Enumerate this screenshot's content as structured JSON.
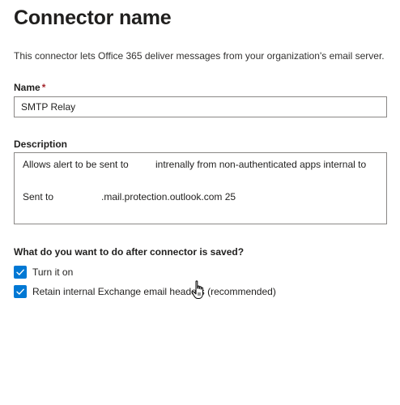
{
  "page": {
    "title": "Connector name",
    "subtitle": "This connector lets Office 365 deliver messages from your organization's email server."
  },
  "name_field": {
    "label": "Name",
    "required_marker": "*",
    "value": "SMTP Relay"
  },
  "description_field": {
    "label": "Description",
    "line1_part1": "Allows alert to be sent to",
    "line1_part2": "intrenally from non-authenticated apps internal to",
    "line2_part1": "Sent to",
    "line2_part2": ".mail.protection.outlook.com 25"
  },
  "options": {
    "question": "What do you want to do after connector is saved?",
    "items": [
      {
        "label": "Turn it on",
        "checked": true
      },
      {
        "label": "Retain internal Exchange email headers (recommended)",
        "checked": true
      }
    ]
  },
  "icons": {
    "checkmark": "checkmark-icon",
    "cursor": "hand-pointer-cursor-icon"
  },
  "colors": {
    "accent": "#0078d4",
    "required": "#a4262c",
    "border": "#8a8886"
  }
}
